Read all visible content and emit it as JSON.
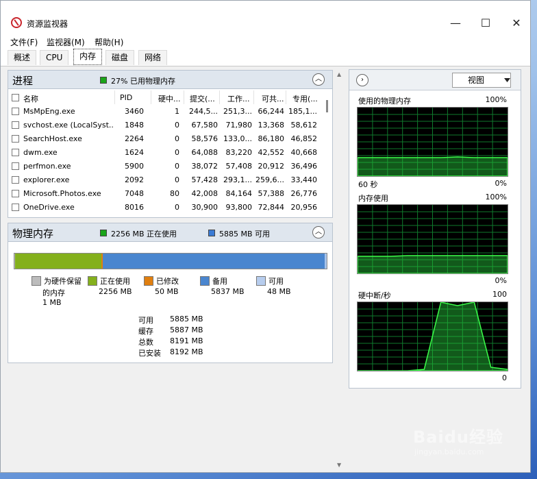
{
  "window": {
    "title": "资源监视器",
    "icon": "resource-monitor-icon"
  },
  "window_controls": {
    "minimize": "—",
    "maximize": "☐",
    "close": "✕"
  },
  "menu": [
    "文件(F)",
    "监视器(M)",
    "帮助(H)"
  ],
  "tabs": [
    "概述",
    "CPU",
    "内存",
    "磁盘",
    "网络"
  ],
  "active_tab": "内存",
  "processes": {
    "title": "进程",
    "usage_text": "27% 已用物理内存",
    "usage_color": "#1aa51a",
    "columns": [
      "名称",
      "PID",
      "硬中...",
      "提交(...",
      "工作...",
      "可共...",
      "专用(..."
    ],
    "rows": [
      [
        "MsMpEng.exe",
        "3460",
        "1",
        "244,5...",
        "251,3...",
        "66,244",
        "185,1..."
      ],
      [
        "svchost.exe (LocalSyst...",
        "1848",
        "0",
        "67,580",
        "71,980",
        "13,368",
        "58,612"
      ],
      [
        "SearchHost.exe",
        "2264",
        "0",
        "58,576",
        "133,0...",
        "86,180",
        "46,852"
      ],
      [
        "dwm.exe",
        "1624",
        "0",
        "64,088",
        "83,220",
        "42,552",
        "40,668"
      ],
      [
        "perfmon.exe",
        "5900",
        "0",
        "38,072",
        "57,408",
        "20,912",
        "36,496"
      ],
      [
        "explorer.exe",
        "2092",
        "0",
        "57,428",
        "293,1...",
        "259,6...",
        "33,440"
      ],
      [
        "Microsoft.Photos.exe",
        "7048",
        "80",
        "42,008",
        "84,164",
        "57,388",
        "26,776"
      ],
      [
        "OneDrive.exe",
        "8016",
        "0",
        "30,900",
        "93,800",
        "72,844",
        "20,956"
      ]
    ]
  },
  "physical_memory": {
    "title": "物理内存",
    "in_use_text": "2256 MB 正在使用",
    "available_text": "5885 MB 可用",
    "in_use_color": "#1aa51a",
    "available_color": "#3a7bd5",
    "bar_segments": [
      {
        "name": "reserved",
        "mb": 1,
        "color": "#b8b8b8"
      },
      {
        "name": "in-use",
        "mb": 2256,
        "color": "#84b01c"
      },
      {
        "name": "modified",
        "mb": 50,
        "color": "#e07f10"
      },
      {
        "name": "standby",
        "mb": 5837,
        "color": "#4a86cf"
      },
      {
        "name": "free",
        "mb": 48,
        "color": "#a7c3ea"
      }
    ],
    "legend": [
      {
        "label": "为硬件保留",
        "label2": "的内存",
        "value": "1 MB",
        "color": "#bcbcbc"
      },
      {
        "label": "正在使用",
        "label2": "",
        "value": "2256 MB",
        "color": "#84b01c"
      },
      {
        "label": "已修改",
        "label2": "",
        "value": "50 MB",
        "color": "#e07f10"
      },
      {
        "label": "备用",
        "label2": "",
        "value": "5837 MB",
        "color": "#4a86cf"
      },
      {
        "label": "可用",
        "label2": "",
        "value": "48 MB",
        "color": "#b7cdee"
      }
    ],
    "summary": [
      {
        "label": "可用",
        "value": "5885 MB"
      },
      {
        "label": "缓存",
        "value": "5887 MB"
      },
      {
        "label": "总数",
        "value": "8191 MB"
      },
      {
        "label": "已安装",
        "value": "8192 MB"
      }
    ]
  },
  "graphs_panel": {
    "view_label": "视图",
    "graphs": [
      {
        "title": "使用的物理内存",
        "max": "100%",
        "time": "60 秒",
        "min": "0%",
        "level_pct": 27,
        "series": [
          0.27,
          0.27,
          0.27,
          0.27,
          0.27,
          0.27,
          0.28,
          0.27,
          0.27,
          0.27
        ]
      },
      {
        "title": "内存使用",
        "max": "100%",
        "time": "",
        "min": "0%",
        "level_pct": 27,
        "series": [
          0.25,
          0.25,
          0.25,
          0.26,
          0.26,
          0.26,
          0.26,
          0.26,
          0.26,
          0.26
        ]
      },
      {
        "title": "硬中断/秒",
        "max": "100",
        "time": "",
        "min": "0",
        "level_pct": 0,
        "series": [
          0,
          0,
          0,
          0,
          0.02,
          1.0,
          0.95,
          1.0,
          0.05,
          0.02
        ]
      }
    ]
  },
  "watermark": {
    "text": "Baidu经验",
    "sub": "jingyan.baidu.com"
  }
}
